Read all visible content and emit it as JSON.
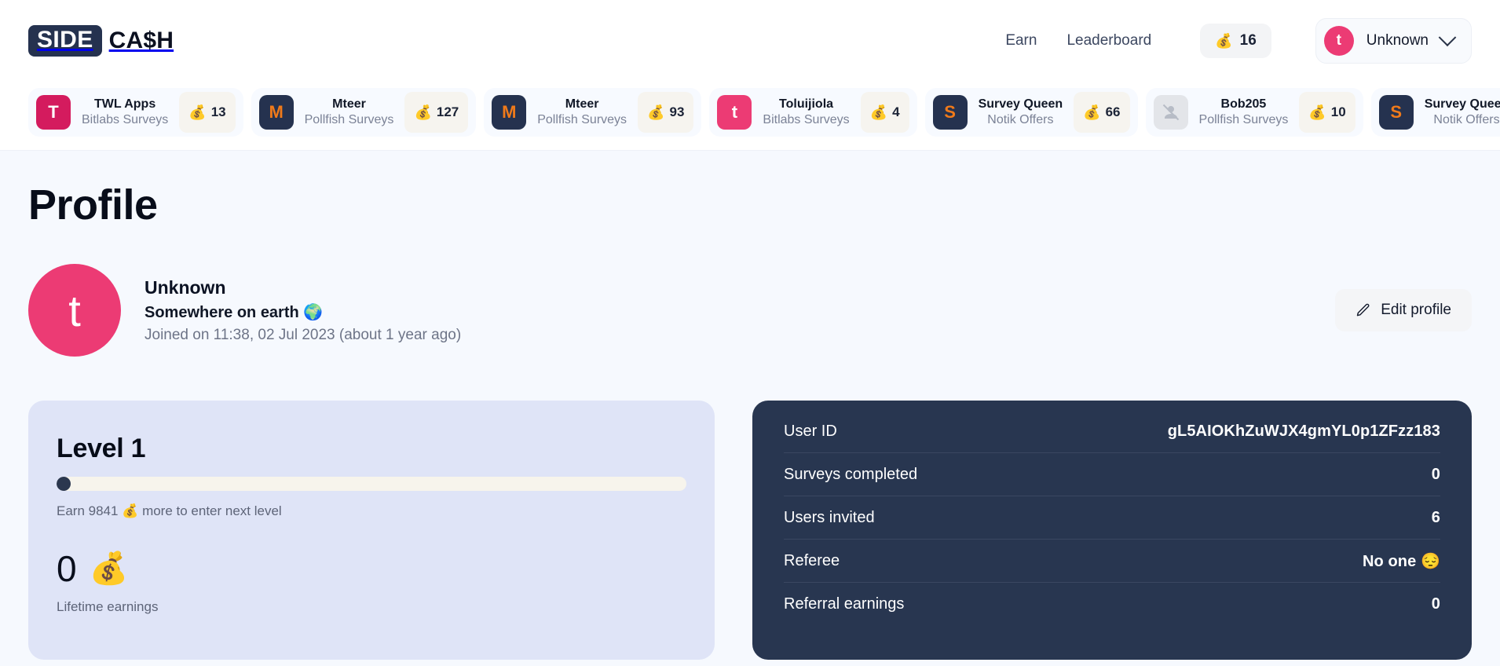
{
  "brand": {
    "badge": "SIDE",
    "word": "CA$H"
  },
  "header": {
    "nav": [
      {
        "label": "Earn"
      },
      {
        "label": "Leaderboard"
      }
    ],
    "coin_balance": "16",
    "coin_icon": "money-bag-emoji",
    "user": {
      "initial": "t",
      "name": "Unknown",
      "chevron": "chevron-down-icon"
    }
  },
  "activity_cards": [
    {
      "initial": "T",
      "logo_color": "pink",
      "name": "TWL Apps",
      "provider": "Bitlabs Surveys",
      "coins": "13"
    },
    {
      "initial": "M",
      "logo_color": "navy",
      "name": "Mteer",
      "provider": "Pollfish Surveys",
      "coins": "127"
    },
    {
      "initial": "M",
      "logo_color": "navy",
      "name": "Mteer",
      "provider": "Pollfish Surveys",
      "coins": "93"
    },
    {
      "initial": "t",
      "logo_color": "pink2",
      "name": "Toluijiola",
      "provider": "Bitlabs Surveys",
      "coins": "4"
    },
    {
      "initial": "S",
      "logo_color": "navy",
      "name": "Survey Queen",
      "provider": "Notik Offers",
      "coins": "66"
    },
    {
      "initial": "",
      "logo_color": "grey",
      "name": "Bob205",
      "provider": "Pollfish Surveys",
      "coins": "10"
    },
    {
      "initial": "S",
      "logo_color": "navy",
      "name": "Survey Queen",
      "provider": "Notik Offers",
      "coins": ""
    }
  ],
  "page": {
    "title": "Profile",
    "profile": {
      "avatar_initial": "t",
      "name": "Unknown",
      "location": "Somewhere on earth 🌍",
      "joined": "Joined on 11:38, 02 Jul 2023 (about 1 year ago)"
    },
    "edit_button": {
      "label": "Edit profile",
      "icon": "pencil-icon"
    }
  },
  "level_card": {
    "title": "Level 1",
    "progress_percent": 1,
    "hint": "Earn 9841 💰 more to enter next level",
    "earnings_value": "0",
    "earnings_emoji": "💰",
    "earnings_label": "Lifetime earnings"
  },
  "stats_card": {
    "rows": [
      {
        "key": "User ID",
        "value": "gL5AIOKhZuWJX4gmYL0p1ZFzz183"
      },
      {
        "key": "Surveys completed",
        "value": "0"
      },
      {
        "key": "Users invited",
        "value": "6"
      },
      {
        "key": "Referee",
        "value": "No one 😔"
      },
      {
        "key": "Referral earnings",
        "value": "0"
      }
    ]
  },
  "colors": {
    "brand_navy": "#25324f",
    "accent_pink": "#ec3b74",
    "accent_orange": "#f07a1a",
    "page_bg": "#f6f9fe",
    "level_card_bg": "#dfe4f7",
    "stats_card_bg": "#283650"
  }
}
